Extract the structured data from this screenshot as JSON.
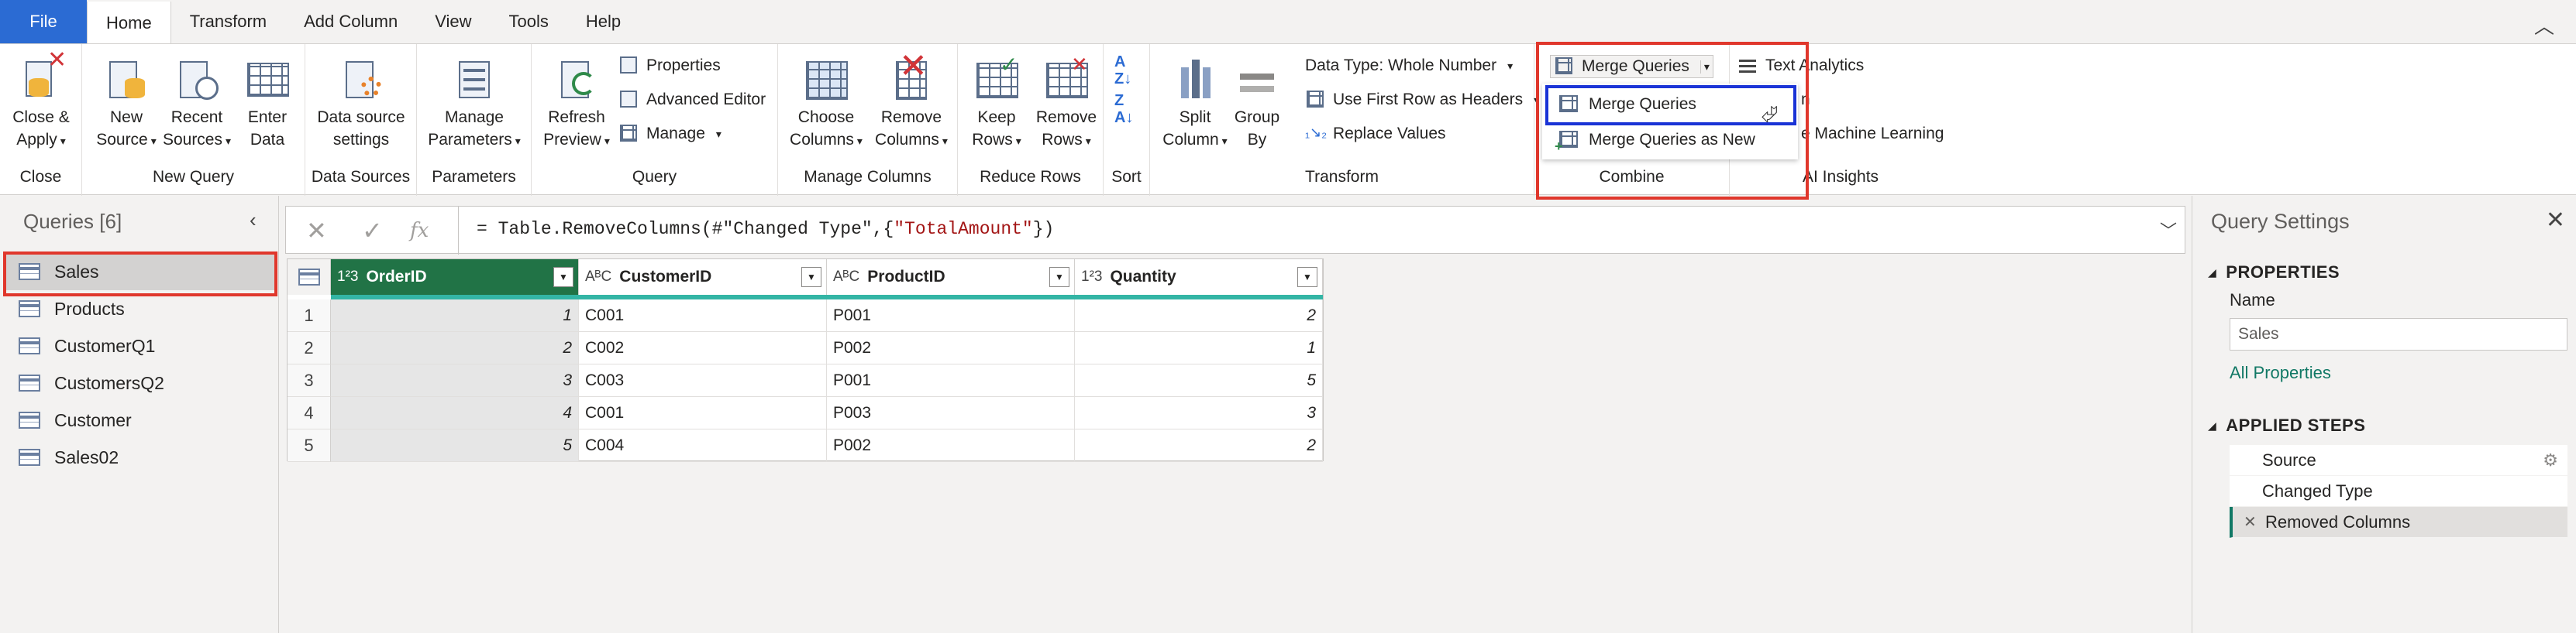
{
  "ribbon_tabs": [
    "File",
    "Home",
    "Transform",
    "Add Column",
    "View",
    "Tools",
    "Help"
  ],
  "active_tab": "Home",
  "ribbon": {
    "close": {
      "btn": [
        "Close &",
        "Apply"
      ],
      "label": "Close"
    },
    "new_query": {
      "new_source": [
        "New",
        "Source"
      ],
      "recent_sources": [
        "Recent",
        "Sources"
      ],
      "enter_data": [
        "Enter",
        "Data"
      ],
      "label": "New Query"
    },
    "data_sources": {
      "btn": [
        "Data source",
        "settings"
      ],
      "label": "Data Sources"
    },
    "parameters": {
      "btn": [
        "Manage",
        "Parameters"
      ],
      "label": "Parameters"
    },
    "query": {
      "refresh": [
        "Refresh",
        "Preview"
      ],
      "properties": "Properties",
      "advanced_editor": "Advanced Editor",
      "manage": "Manage",
      "label": "Query"
    },
    "manage_columns": {
      "choose": [
        "Choose",
        "Columns"
      ],
      "remove": [
        "Remove",
        "Columns"
      ],
      "label": "Manage Columns"
    },
    "reduce_rows": {
      "keep": [
        "Keep",
        "Rows"
      ],
      "remove": [
        "Remove",
        "Rows"
      ],
      "label": "Reduce Rows"
    },
    "sort": {
      "label": "Sort"
    },
    "transform": {
      "split": [
        "Split",
        "Column"
      ],
      "group": [
        "Group",
        "By"
      ],
      "data_type": "Data Type: Whole Number",
      "first_row": "Use First Row as Headers",
      "replace": "Replace Values",
      "label": "Transform"
    },
    "combine": {
      "merge_queries": "Merge Queries",
      "label": "Combine"
    },
    "ai": {
      "text_analytics": "Text Analytics",
      "vision": "n",
      "ml": "e Machine Learning",
      "label": "AI Insights"
    }
  },
  "dropdown": {
    "items": [
      "Merge Queries",
      "Merge Queries as New"
    ]
  },
  "queries_panel": {
    "title": "Queries [6]",
    "items": [
      "Sales",
      "Products",
      "CustomerQ1",
      "CustomersQ2",
      "Customer",
      "Sales02"
    ],
    "selected": "Sales"
  },
  "formula": {
    "prefix": "= Table.RemoveColumns(#\"Changed Type\",{",
    "string": "\"TotalAmount\"",
    "suffix": "})"
  },
  "table": {
    "columns": [
      {
        "type": "1²3",
        "name": "OrderID"
      },
      {
        "type": "AᴮC",
        "name": "CustomerID"
      },
      {
        "type": "AᴮC",
        "name": "ProductID"
      },
      {
        "type": "1²3",
        "name": "Quantity"
      }
    ],
    "rows": [
      [
        "1",
        "1",
        "C001",
        "P001",
        "2"
      ],
      [
        "2",
        "2",
        "C002",
        "P002",
        "1"
      ],
      [
        "3",
        "3",
        "C003",
        "P001",
        "5"
      ],
      [
        "4",
        "4",
        "C001",
        "P003",
        "3"
      ],
      [
        "5",
        "5",
        "C004",
        "P002",
        "2"
      ]
    ]
  },
  "query_settings": {
    "title": "Query Settings",
    "properties_header": "PROPERTIES",
    "name_label": "Name",
    "name_value": "Sales",
    "all_properties": "All Properties",
    "steps_header": "APPLIED STEPS",
    "steps": [
      "Source",
      "Changed Type",
      "Removed Columns"
    ]
  },
  "colors": {
    "accent": "#217346",
    "file_tab": "#2b6bd3",
    "highlight_red": "#e0372c",
    "highlight_blue": "#1a33d6",
    "link": "#117865"
  }
}
